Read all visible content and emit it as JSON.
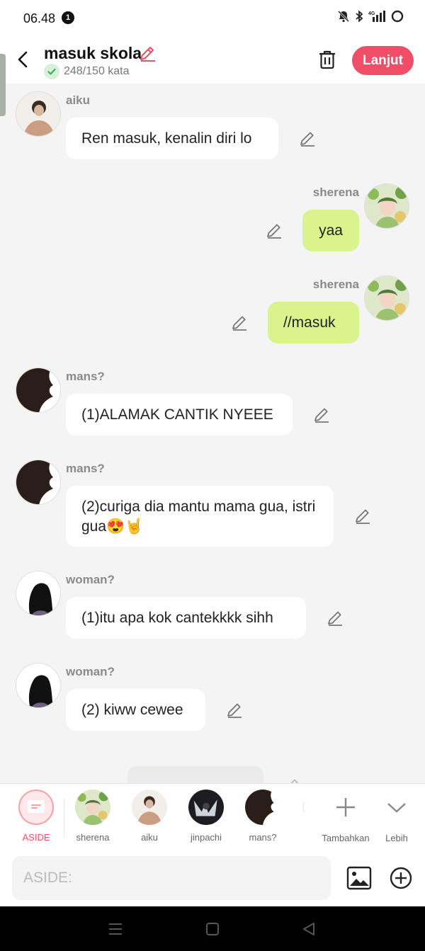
{
  "status_bar": {
    "time": "06.48",
    "notification_count": "1"
  },
  "header": {
    "title": "masuk skola",
    "word_count": "248/150 kata",
    "next_label": "Lanjut"
  },
  "messages": [
    {
      "sender": "aiku",
      "text": "Ren masuk, kenalin diri lo"
    },
    {
      "sender": "sherena",
      "text": "yaa"
    },
    {
      "sender": "sherena",
      "text": "//masuk"
    },
    {
      "sender": "mans?",
      "text": "(1)ALAMAK CANTIK NYEEE"
    },
    {
      "sender": "mans?",
      "text": "(2)curiga dia mantu mama gua, istri gua😍🤘"
    },
    {
      "sender": "woman?",
      "text": "(1)itu apa kok cantekkkk sihh"
    },
    {
      "sender": "woman?",
      "text": "(2) kiww cewee"
    }
  ],
  "characters": [
    {
      "label": "ASIDE"
    },
    {
      "label": "sherena"
    },
    {
      "label": "aiku"
    },
    {
      "label": "jinpachi"
    },
    {
      "label": "mans?"
    }
  ],
  "actions": {
    "add_label": "Tambahkan",
    "more_label": "Lebih"
  },
  "input": {
    "placeholder": "ASIDE:"
  },
  "colors": {
    "accent": "#f04e67",
    "outgoing_bubble": "#d9f38d",
    "background": "#f4f4f4"
  }
}
